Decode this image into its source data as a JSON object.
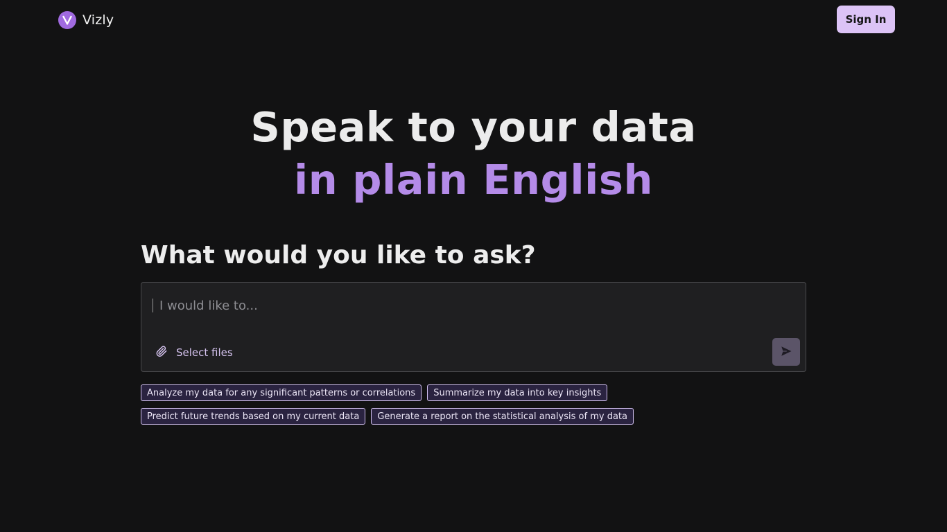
{
  "header": {
    "brand_name": "Vizly",
    "logo_letter": "V",
    "sign_in_label": "Sign In"
  },
  "hero": {
    "line1": "Speak to your data",
    "line2": "in plain English"
  },
  "prompt": {
    "heading": "What would you like to ask?",
    "placeholder": "I would like to...",
    "value": "",
    "select_files_label": "Select files",
    "attach_icon": "paperclip-icon",
    "send_icon": "send-icon"
  },
  "suggestions": [
    "Analyze my data for any significant patterns or correlations",
    "Summarize my data into key insights",
    "Predict future trends based on my current data",
    "Generate a report on the statistical analysis of my data"
  ],
  "colors": {
    "background": "#121213",
    "accent": "#b48be8",
    "sign_in_bg": "#dcc3f6",
    "chip_bg": "#2a2340",
    "chip_border": "#d4c2f2"
  }
}
